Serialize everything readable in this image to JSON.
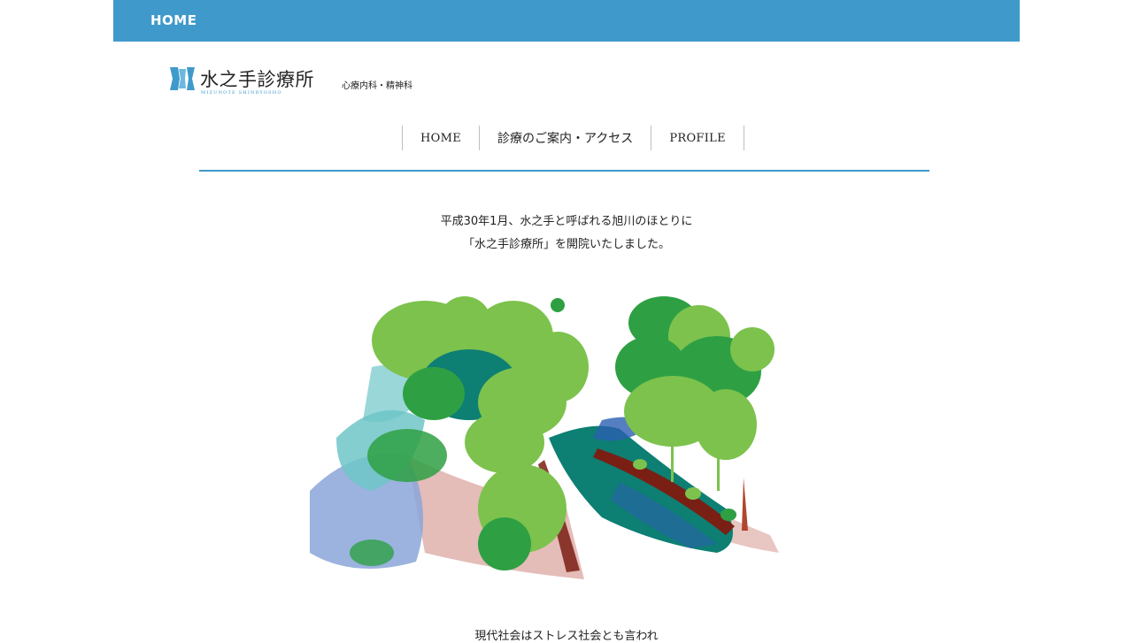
{
  "header": {
    "home_label": "HOME",
    "bar_color": "#3f9acb"
  },
  "logo": {
    "name": "水之手診療所",
    "romaji": "MIZUNOTE SHINRYOSHO",
    "icon": "clinic-logo-mark"
  },
  "tagline": "心療内科・精神科",
  "nav": {
    "items": [
      {
        "label": "HOME"
      },
      {
        "label": "診療のご案内・アクセス"
      },
      {
        "label": "PROFILE"
      }
    ]
  },
  "intro": {
    "line1": "平成30年1月、水之手と呼ばれる旭川のほとりに",
    "line2": "「水之手診療所」を開院いたしました。"
  },
  "hero": {
    "image": "watercolor-forest-river-illustration",
    "colors": [
      "#7cc24d",
      "#2ea043",
      "#0d7f73",
      "#8aa6d8",
      "#6fc6c8",
      "#7a1f14",
      "#d9a09a"
    ]
  },
  "body": {
    "partial_line": "現代社会はストレス社会とも言われ"
  }
}
